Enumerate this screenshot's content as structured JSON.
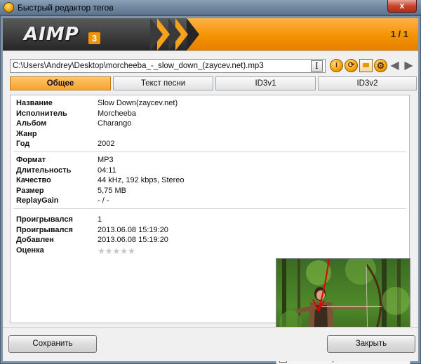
{
  "window": {
    "title": "Быстрый редактор тегов",
    "close_label": "x"
  },
  "banner": {
    "logo_text": "AIMP",
    "logo_number": "3",
    "counter": "1 / 1"
  },
  "file_path": "C:\\Users\\Andrey\\Desktop\\morcheeba_-_slow_down_(zaycev.net).mp3",
  "tabs": [
    {
      "label": "Общее",
      "active": true
    },
    {
      "label": "Текст песни",
      "active": false
    },
    {
      "label": "ID3v1",
      "active": false
    },
    {
      "label": "ID3v2",
      "active": false
    }
  ],
  "tags": [
    {
      "label": "Название",
      "value": "Slow Down(zaycev.net)"
    },
    {
      "label": "Исполнитель",
      "value": "Morcheeba"
    },
    {
      "label": "Альбом",
      "value": "Charango"
    },
    {
      "label": "Жанр",
      "value": ""
    },
    {
      "label": "Год",
      "value": "2002"
    }
  ],
  "tech": [
    {
      "label": "Формат",
      "value": "MP3"
    },
    {
      "label": "Длительность",
      "value": "04:11"
    },
    {
      "label": "Качество",
      "value": "44 kHz, 192 kbps, Stereo"
    },
    {
      "label": "Размер",
      "value": "5,75 MB"
    },
    {
      "label": "ReplayGain",
      "value": "- / -"
    }
  ],
  "stats": [
    {
      "label": "Проигрывался",
      "value": "1"
    },
    {
      "label": "Проигрывался",
      "value": "2013.06.08 15:19:20"
    },
    {
      "label": "Добавлен",
      "value": "2013.06.08 15:19:20"
    },
    {
      "label": "Оценка",
      "value": ""
    }
  ],
  "rating": {
    "stars": "★★★★★",
    "value": 0,
    "max": 5
  },
  "cover": {
    "embed_label": "Вложить в файл",
    "embed_checked": true
  },
  "buttons": {
    "save": "Сохранить",
    "close": "Закрыть"
  },
  "colors": {
    "accent": "#f39300",
    "tab_active": "#f5a431",
    "annotation_arrow": "#e00000"
  }
}
